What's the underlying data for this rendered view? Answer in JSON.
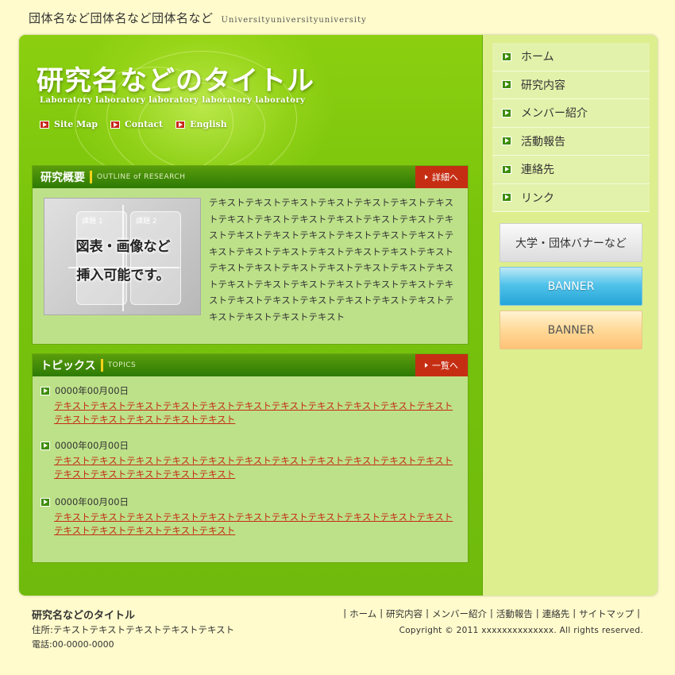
{
  "header": {
    "org_name": "団体名など団体名など団体名など",
    "org_sub": "Universityuniversityuniversity",
    "title": "研究名などのタイトル",
    "subtitle": "Laboratory laboratory laboratory laboratory laboratory",
    "nav": [
      {
        "label": "Site Map"
      },
      {
        "label": "Contact"
      },
      {
        "label": "English"
      }
    ]
  },
  "outline": {
    "heading": "研究概要",
    "heading_en": "OUTLINE of RESEARCH",
    "more_label": "詳細へ",
    "figure": {
      "card1": "課題 1",
      "card2": "課題 2",
      "line1": "図表・画像など",
      "line2": "挿入可能です。"
    },
    "text": "テキストテキストテキストテキストテキストテキストテキストテキストテキストテキストテキストテキストテキストテキストテキストテキストテキストテキストテキストテキストテキストテキストテキストテキストテキストテキストテキストテキストテキストテキストテキストテキストテキストテキストテキストテキストテキストテキストテキストテキストテキストテキストテキストテキストテキストテキストテキストテキストテキストテキストテキスト"
  },
  "topics": {
    "heading": "トピックス",
    "heading_en": "TOPICS",
    "more_label": "一覧へ",
    "items": [
      {
        "date": "0000年00月00日",
        "text": "テキストテキストテキストテキストテキストテキストテキストテキストテキストテキストテキストテキストテキストテキストテキストテキスト"
      },
      {
        "date": "0000年00月00日",
        "text": "テキストテキストテキストテキストテキストテキストテキストテキストテキストテキストテキストテキストテキストテキストテキストテキスト"
      },
      {
        "date": "0000年00月00日",
        "text": "テキストテキストテキストテキストテキストテキストテキストテキストテキストテキストテキストテキストテキストテキストテキストテキスト"
      }
    ]
  },
  "sidenav": {
    "items": [
      {
        "label": "ホーム"
      },
      {
        "label": "研究内容"
      },
      {
        "label": "メンバー紹介"
      },
      {
        "label": "活動報告"
      },
      {
        "label": "連絡先"
      },
      {
        "label": "リンク"
      }
    ]
  },
  "banners": {
    "b1": "大学・団体バナーなど",
    "b2": "BANNER",
    "b3": "BANNER"
  },
  "footer": {
    "title": "研究名などのタイトル",
    "address": "住所:テキストテキストテキストテキストテキスト",
    "tel": "電話:00-0000-0000",
    "nav": [
      {
        "label": "ホーム"
      },
      {
        "label": "研究内容"
      },
      {
        "label": "メンバー紹介"
      },
      {
        "label": "活動報告"
      },
      {
        "label": "連絡先"
      },
      {
        "label": "サイトマップ"
      }
    ],
    "copyright": "Copyright © 2011 xxxxxxxxxxxxxx. All rights reserved."
  },
  "colors": {
    "page_bg": "#fffbcc",
    "main_green": "#78c40c",
    "box_head": "#2d7a05",
    "accent_red": "#c62e14",
    "link_red": "#c32b10",
    "sidebar_bg": "#dcee8e"
  }
}
